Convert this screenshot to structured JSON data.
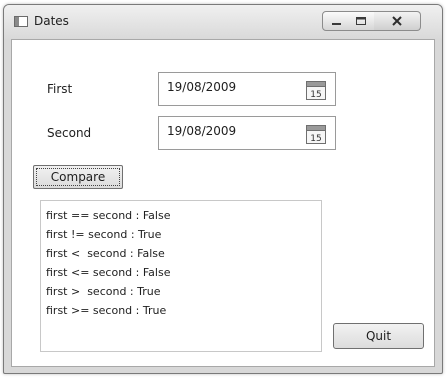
{
  "window": {
    "title": "Dates"
  },
  "form": {
    "first": {
      "label": "First",
      "value": "19/08/2009",
      "calendar_day": "15"
    },
    "second": {
      "label": "Second",
      "value": "19/08/2009",
      "calendar_day": "15"
    },
    "compare_label": "Compare",
    "quit_label": "Quit"
  },
  "results": [
    "first == second : False",
    "first != second : True",
    "first <  second : False",
    "first <= second : False",
    "first >  second : True",
    "first >= second : True"
  ],
  "icons": {
    "window": "window-app-icon",
    "minimize": "minimize-icon",
    "maximize": "maximize-icon",
    "close": "close-icon",
    "calendar": "calendar-icon"
  }
}
